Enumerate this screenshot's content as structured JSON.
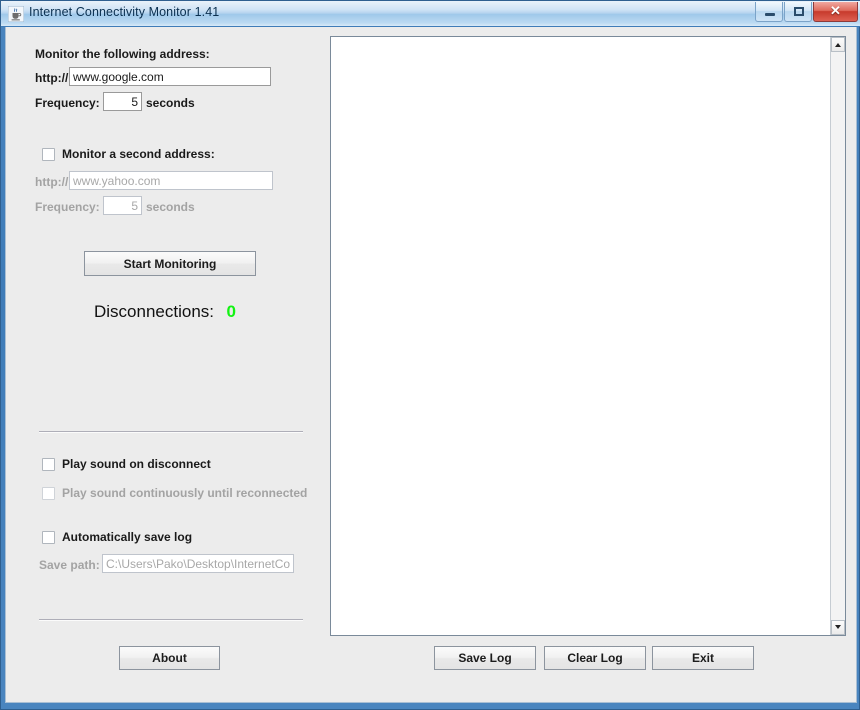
{
  "window": {
    "title": "Internet Connectivity Monitor 1.41",
    "icon": "java-coffee-cup-icon",
    "controls": {
      "minimize": "minimize-icon",
      "maximize": "maximize-icon",
      "close": "✕"
    }
  },
  "primary": {
    "heading": "Monitor the following address:",
    "protocol_label": "http://",
    "address_value": "www.google.com",
    "frequency_label": "Frequency:",
    "frequency_value": "5",
    "frequency_units": "seconds"
  },
  "secondary": {
    "checkbox_label": "Monitor a second address:",
    "checked": false,
    "enabled": false,
    "protocol_label": "http://",
    "address_value": "www.yahoo.com",
    "frequency_label": "Frequency:",
    "frequency_value": "5",
    "frequency_units": "seconds"
  },
  "actions": {
    "start_monitoring": "Start Monitoring"
  },
  "status": {
    "disconnections_label": "Disconnections:",
    "disconnections_count": "0",
    "count_color": "#12f312"
  },
  "sound_options": {
    "play_on_disconnect": {
      "label": "Play sound on disconnect",
      "checked": false,
      "enabled": true
    },
    "play_continuously": {
      "label": "Play sound continuously until reconnected",
      "checked": false,
      "enabled": false
    }
  },
  "log_options": {
    "auto_save": {
      "label": "Automatically save log",
      "checked": false,
      "enabled": true
    },
    "save_path_label": "Save path:",
    "save_path_value": "C:\\Users\\Pako\\Desktop\\InternetCo",
    "save_path_enabled": false
  },
  "log_panel": {
    "content": ""
  },
  "footer": {
    "about": "About",
    "save_log": "Save Log",
    "clear_log": "Clear Log",
    "exit": "Exit"
  }
}
